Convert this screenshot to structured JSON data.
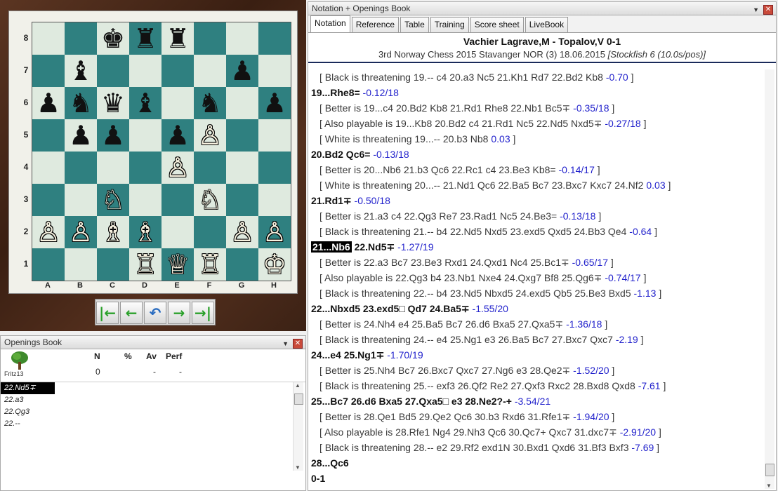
{
  "board": {
    "ranks": [
      "8",
      "7",
      "6",
      "5",
      "4",
      "3",
      "2",
      "1"
    ],
    "files": [
      "A",
      "B",
      "C",
      "D",
      "E",
      "F",
      "G",
      "H"
    ],
    "pieces": [
      {
        "sq": "c8",
        "glyph": "♚",
        "color": "b",
        "name": "black-king-icon"
      },
      {
        "sq": "d8",
        "glyph": "♜",
        "color": "b",
        "name": "black-rook-icon"
      },
      {
        "sq": "e8",
        "glyph": "♜",
        "color": "b",
        "name": "black-rook-icon"
      },
      {
        "sq": "b7",
        "glyph": "♝",
        "color": "b",
        "name": "black-bishop-icon"
      },
      {
        "sq": "g7",
        "glyph": "♟",
        "color": "b",
        "name": "black-pawn-icon"
      },
      {
        "sq": "a6",
        "glyph": "♟",
        "color": "b",
        "name": "black-pawn-icon"
      },
      {
        "sq": "b6",
        "glyph": "♞",
        "color": "b",
        "name": "black-knight-icon"
      },
      {
        "sq": "c6",
        "glyph": "♛",
        "color": "b",
        "name": "black-queen-icon"
      },
      {
        "sq": "d6",
        "glyph": "♝",
        "color": "b",
        "name": "black-bishop-icon"
      },
      {
        "sq": "f6",
        "glyph": "♞",
        "color": "b",
        "name": "black-knight-icon"
      },
      {
        "sq": "h6",
        "glyph": "♟",
        "color": "b",
        "name": "black-pawn-icon"
      },
      {
        "sq": "b5",
        "glyph": "♟",
        "color": "b",
        "name": "black-pawn-icon"
      },
      {
        "sq": "c5",
        "glyph": "♟",
        "color": "b",
        "name": "black-pawn-icon"
      },
      {
        "sq": "e5",
        "glyph": "♟",
        "color": "b",
        "name": "black-pawn-icon"
      },
      {
        "sq": "f5",
        "glyph": "♙",
        "color": "w",
        "name": "white-pawn-icon"
      },
      {
        "sq": "e4",
        "glyph": "♙",
        "color": "w",
        "name": "white-pawn-icon"
      },
      {
        "sq": "c3",
        "glyph": "♘",
        "color": "w",
        "name": "white-knight-icon"
      },
      {
        "sq": "f3",
        "glyph": "♘",
        "color": "w",
        "name": "white-knight-icon"
      },
      {
        "sq": "a2",
        "glyph": "♙",
        "color": "w",
        "name": "white-pawn-icon"
      },
      {
        "sq": "b2",
        "glyph": "♙",
        "color": "w",
        "name": "white-pawn-icon"
      },
      {
        "sq": "c2",
        "glyph": "♗",
        "color": "w",
        "name": "white-bishop-icon"
      },
      {
        "sq": "d2",
        "glyph": "♗",
        "color": "w",
        "name": "white-bishop-icon"
      },
      {
        "sq": "g2",
        "glyph": "♙",
        "color": "w",
        "name": "white-pawn-icon"
      },
      {
        "sq": "h2",
        "glyph": "♙",
        "color": "w",
        "name": "white-pawn-icon"
      },
      {
        "sq": "d1",
        "glyph": "♖",
        "color": "w",
        "name": "white-rook-icon"
      },
      {
        "sq": "e1",
        "glyph": "♕",
        "color": "w",
        "name": "white-queen-icon"
      },
      {
        "sq": "f1",
        "glyph": "♖",
        "color": "w",
        "name": "white-rook-icon"
      },
      {
        "sq": "h1",
        "glyph": "♔",
        "color": "w",
        "name": "white-king-icon"
      }
    ],
    "nav": [
      {
        "name": "first-move-button",
        "glyph": "|←"
      },
      {
        "name": "prev-move-button",
        "glyph": "←"
      },
      {
        "name": "takeback-button",
        "glyph": "↶"
      },
      {
        "name": "next-move-button",
        "glyph": "→"
      },
      {
        "name": "last-move-button",
        "glyph": "→|"
      }
    ]
  },
  "book": {
    "title": "Openings Book",
    "columns": {
      "n": "N",
      "pct": "%",
      "av": "Av",
      "perf": "Perf"
    },
    "engine": "Fritz13",
    "row": {
      "n": "0",
      "pct": "",
      "av": "-",
      "perf": "-"
    },
    "moves": [
      "22.Nd5∓",
      "22.a3",
      "22.Qg3",
      "22.--"
    ]
  },
  "notation": {
    "title": "Notation + Openings Book",
    "tabs": [
      "Notation",
      "Reference",
      "Table",
      "Training",
      "Score sheet",
      "LiveBook"
    ],
    "players": "Vachier Lagrave,M - Topalov,V  0-1",
    "event": "3rd Norway Chess 2015 Stavanger NOR (3) 18.06.2015 ",
    "annotator": "[Stockfish 6 (10.0s/pos)]",
    "lines": [
      {
        "t": "var",
        "text": "[ Black is threatening 19.--  c4  20.a3  Nc5  21.Kh1  Rd7  22.Bd2  Kb8 ",
        "eval": "-0.70",
        "end": " ]"
      },
      {
        "t": "main",
        "text": "19...Rhe8= ",
        "eval": "-0.12/18",
        "end": ""
      },
      {
        "t": "var",
        "text": "[ Better is 19...c4  20.Bd2  Kb8  21.Rd1  Rhe8  22.Nb1  Bc5∓ ",
        "eval": "-0.35/18",
        "end": " ]"
      },
      {
        "t": "var",
        "text": "[ Also playable is 19...Kb8  20.Bd2  c4  21.Rd1  Nc5  22.Nd5  Nxd5∓ ",
        "eval": "-0.27/18",
        "end": " ]"
      },
      {
        "t": "var",
        "text": "[ White is threatening 19...--  20.b3  Nb8 ",
        "eval": "0.03",
        "end": " ]"
      },
      {
        "t": "main",
        "text": "20.Bd2  Qc6= ",
        "eval": "-0.13/18",
        "end": ""
      },
      {
        "t": "var",
        "text": "[ Better is 20...Nb6  21.b3  Qc6  22.Rc1  c4  23.Be3  Kb8= ",
        "eval": "-0.14/17",
        "end": " ]"
      },
      {
        "t": "var",
        "text": "[ White is threatening 20...--  21.Nd1  Qc6  22.Ba5  Bc7  23.Bxc7  Kxc7  24.Nf2 ",
        "eval": "0.03",
        "end": " ]"
      },
      {
        "t": "main",
        "text": "21.Rd1∓ ",
        "eval": "-0.50/18",
        "end": ""
      },
      {
        "t": "var",
        "text": "[ Better is 21.a3  c4  22.Qg3  Re7  23.Rad1  Nc5  24.Be3= ",
        "eval": "-0.13/18",
        "end": " ]"
      },
      {
        "t": "var",
        "text": "[ Black is threatening 21.--  b4  22.Nd5  Nxd5  23.exd5  Qxd5  24.Bb3  Qe4 ",
        "eval": "-0.64",
        "end": " ]"
      },
      {
        "t": "main",
        "hl": "21...Nb6",
        "text": " 22.Nd5∓ ",
        "eval": "-1.27/19",
        "end": ""
      },
      {
        "t": "var",
        "text": "[ Better is 22.a3  Bc7  23.Be3  Rxd1  24.Qxd1  Nc4  25.Bc1∓ ",
        "eval": "-0.65/17",
        "end": " ]"
      },
      {
        "t": "var",
        "text": "[ Also playable is 22.Qg3  b4  23.Nb1  Nxe4  24.Qxg7  Bf8  25.Qg6∓ ",
        "eval": "-0.74/17",
        "end": " ]"
      },
      {
        "t": "var",
        "text": "[ Black is threatening 22.--  b4  23.Nd5  Nbxd5  24.exd5  Qb5  25.Be3  Bxd5 ",
        "eval": "-1.13",
        "end": " ]"
      },
      {
        "t": "main",
        "text": "22...Nbxd5  23.exd5□  Qd7  24.Ba5∓ ",
        "eval": "-1.55/20",
        "end": ""
      },
      {
        "t": "var",
        "text": "[ Better is 24.Nh4  e4  25.Ba5  Bc7  26.d6  Bxa5  27.Qxa5∓ ",
        "eval": "-1.36/18",
        "end": " ]"
      },
      {
        "t": "var",
        "text": "[ Black is threatening 24.--  e4  25.Ng1  e3  26.Ba5  Bc7  27.Bxc7  Qxc7 ",
        "eval": "-2.19",
        "end": " ]"
      },
      {
        "t": "main",
        "text": "24...e4  25.Ng1∓ ",
        "eval": "-1.70/19",
        "end": ""
      },
      {
        "t": "var",
        "text": "[ Better is 25.Nh4  Bc7  26.Bxc7  Qxc7  27.Ng6  e3  28.Qe2∓ ",
        "eval": "-1.52/20",
        "end": " ]"
      },
      {
        "t": "var",
        "text": "[ Black is threatening 25.--  exf3  26.Qf2  Re2  27.Qxf3  Rxc2  28.Bxd8  Qxd8 ",
        "eval": "-7.61",
        "end": " ]"
      },
      {
        "t": "main",
        "text": "25...Bc7  26.d6  Bxa5  27.Qxa5□  e3  28.Ne2?-+ ",
        "eval": "-3.54/21",
        "end": ""
      },
      {
        "t": "var",
        "text": "[ Better is 28.Qe1  Bd5  29.Qe2  Qc6  30.b3  Rxd6  31.Rfe1∓ ",
        "eval": "-1.94/20",
        "end": " ]"
      },
      {
        "t": "var",
        "text": "[ Also playable is 28.Rfe1  Ng4  29.Nh3  Qc6  30.Qc7+  Qxc7  31.dxc7∓ ",
        "eval": "-2.91/20",
        "end": " ]"
      },
      {
        "t": "var",
        "text": "[ Black is threatening 28.--  e2  29.Rf2  exd1N  30.Bxd1  Qxd6  31.Bf3  Bxf3 ",
        "eval": "-7.69",
        "end": " ]"
      },
      {
        "t": "main",
        "text": "28...Qc6",
        "eval": "",
        "end": ""
      },
      {
        "t": "main",
        "text": "0-1",
        "eval": "",
        "end": ""
      }
    ]
  }
}
